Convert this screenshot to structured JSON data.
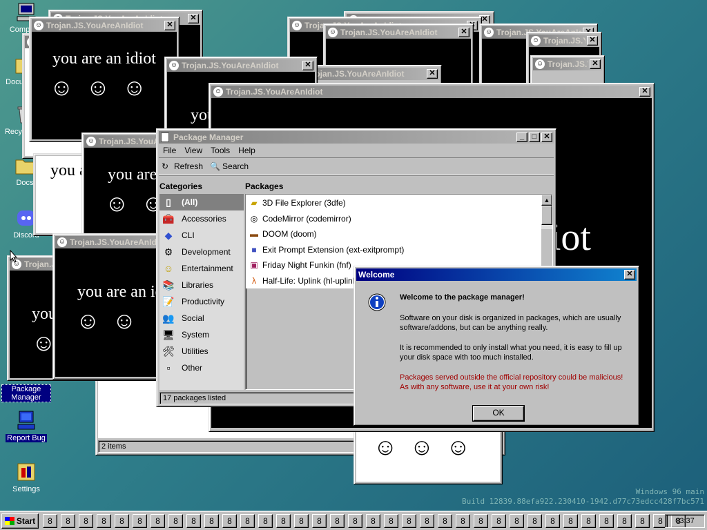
{
  "desktop": {
    "icons": [
      {
        "label": "Computer"
      },
      {
        "label": "Documents"
      },
      {
        "label": "Recycle Bin"
      },
      {
        "label": "Docs"
      },
      {
        "label": "Discord"
      },
      {
        "label": "Package Manager"
      },
      {
        "label": "Report Bug"
      },
      {
        "label": "Settings"
      }
    ],
    "build": {
      "line1": "Windows 96 main",
      "line2": "Build 12839.88efa922.230410-1942.d77c73edcc428f7bc571"
    }
  },
  "idiot": {
    "title": "Trojan.JS.YouAreAnIdiot",
    "message": "you are an idiot",
    "smiley": "☺",
    "fragment": "iot"
  },
  "explorer": {
    "status": "2 items"
  },
  "pkgmgr": {
    "title": "Package Manager",
    "menu": [
      "File",
      "View",
      "Tools",
      "Help"
    ],
    "toolbar": {
      "refresh": "Refresh",
      "search": "Search"
    },
    "categories_header": "Categories",
    "packages_header": "Packages",
    "categories": [
      "(All)",
      "Accessories",
      "CLI",
      "Development",
      "Entertainment",
      "Libraries",
      "Productivity",
      "Social",
      "System",
      "Utilities",
      "Other"
    ],
    "packages": [
      "3D File Explorer (3dfe)",
      "CodeMirror (codemirror)",
      "DOOM (doom)",
      "Exit Prompt Extension (ext-exitprompt)",
      "Friday Night Funkin (fnf)",
      "Half-Life: Uplink (hl-uplink)"
    ],
    "status": "17 packages listed"
  },
  "welcome": {
    "title": "Welcome",
    "heading": "Welcome to the package manager!",
    "p1": "Software on your disk is organized in packages, which are usually software/addons, but can be anything really.",
    "p2": "It is recommended to only install what you need, it is easy to fill up your disk space with too much installed.",
    "p3": "Packages served outside the official repository could be malicious! As with any software, use it at your own risk!",
    "ok": "OK",
    "warn_color": "#a00000"
  },
  "taskbar": {
    "start": "Start",
    "clock": "03:37",
    "slot_glyph": "8"
  },
  "colors": {
    "active_title": "#000080",
    "inactive_title": "#808080",
    "face": "#c0c0c0"
  }
}
